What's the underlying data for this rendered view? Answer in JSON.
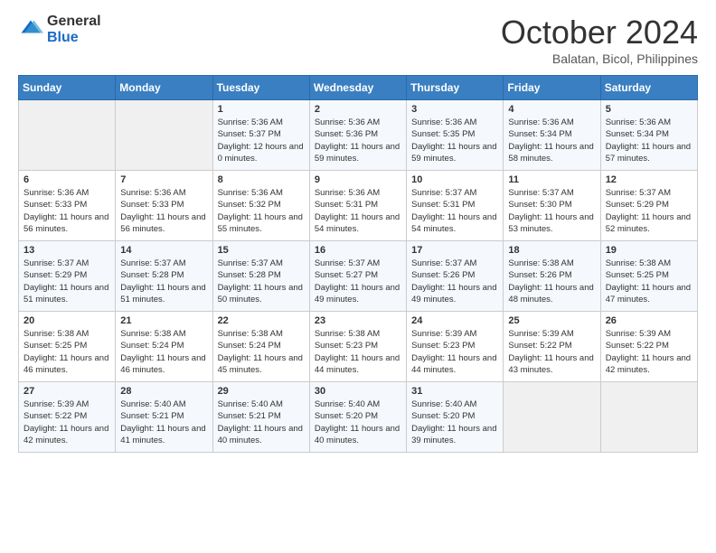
{
  "logo": {
    "general": "General",
    "blue": "Blue"
  },
  "header": {
    "month": "October 2024",
    "location": "Balatan, Bicol, Philippines"
  },
  "days_of_week": [
    "Sunday",
    "Monday",
    "Tuesday",
    "Wednesday",
    "Thursday",
    "Friday",
    "Saturday"
  ],
  "weeks": [
    [
      {
        "day": "",
        "info": ""
      },
      {
        "day": "",
        "info": ""
      },
      {
        "day": "1",
        "sunrise": "Sunrise: 5:36 AM",
        "sunset": "Sunset: 5:37 PM",
        "daylight": "Daylight: 12 hours and 0 minutes."
      },
      {
        "day": "2",
        "sunrise": "Sunrise: 5:36 AM",
        "sunset": "Sunset: 5:36 PM",
        "daylight": "Daylight: 11 hours and 59 minutes."
      },
      {
        "day": "3",
        "sunrise": "Sunrise: 5:36 AM",
        "sunset": "Sunset: 5:35 PM",
        "daylight": "Daylight: 11 hours and 59 minutes."
      },
      {
        "day": "4",
        "sunrise": "Sunrise: 5:36 AM",
        "sunset": "Sunset: 5:34 PM",
        "daylight": "Daylight: 11 hours and 58 minutes."
      },
      {
        "day": "5",
        "sunrise": "Sunrise: 5:36 AM",
        "sunset": "Sunset: 5:34 PM",
        "daylight": "Daylight: 11 hours and 57 minutes."
      }
    ],
    [
      {
        "day": "6",
        "sunrise": "Sunrise: 5:36 AM",
        "sunset": "Sunset: 5:33 PM",
        "daylight": "Daylight: 11 hours and 56 minutes."
      },
      {
        "day": "7",
        "sunrise": "Sunrise: 5:36 AM",
        "sunset": "Sunset: 5:33 PM",
        "daylight": "Daylight: 11 hours and 56 minutes."
      },
      {
        "day": "8",
        "sunrise": "Sunrise: 5:36 AM",
        "sunset": "Sunset: 5:32 PM",
        "daylight": "Daylight: 11 hours and 55 minutes."
      },
      {
        "day": "9",
        "sunrise": "Sunrise: 5:36 AM",
        "sunset": "Sunset: 5:31 PM",
        "daylight": "Daylight: 11 hours and 54 minutes."
      },
      {
        "day": "10",
        "sunrise": "Sunrise: 5:37 AM",
        "sunset": "Sunset: 5:31 PM",
        "daylight": "Daylight: 11 hours and 54 minutes."
      },
      {
        "day": "11",
        "sunrise": "Sunrise: 5:37 AM",
        "sunset": "Sunset: 5:30 PM",
        "daylight": "Daylight: 11 hours and 53 minutes."
      },
      {
        "day": "12",
        "sunrise": "Sunrise: 5:37 AM",
        "sunset": "Sunset: 5:29 PM",
        "daylight": "Daylight: 11 hours and 52 minutes."
      }
    ],
    [
      {
        "day": "13",
        "sunrise": "Sunrise: 5:37 AM",
        "sunset": "Sunset: 5:29 PM",
        "daylight": "Daylight: 11 hours and 51 minutes."
      },
      {
        "day": "14",
        "sunrise": "Sunrise: 5:37 AM",
        "sunset": "Sunset: 5:28 PM",
        "daylight": "Daylight: 11 hours and 51 minutes."
      },
      {
        "day": "15",
        "sunrise": "Sunrise: 5:37 AM",
        "sunset": "Sunset: 5:28 PM",
        "daylight": "Daylight: 11 hours and 50 minutes."
      },
      {
        "day": "16",
        "sunrise": "Sunrise: 5:37 AM",
        "sunset": "Sunset: 5:27 PM",
        "daylight": "Daylight: 11 hours and 49 minutes."
      },
      {
        "day": "17",
        "sunrise": "Sunrise: 5:37 AM",
        "sunset": "Sunset: 5:26 PM",
        "daylight": "Daylight: 11 hours and 49 minutes."
      },
      {
        "day": "18",
        "sunrise": "Sunrise: 5:38 AM",
        "sunset": "Sunset: 5:26 PM",
        "daylight": "Daylight: 11 hours and 48 minutes."
      },
      {
        "day": "19",
        "sunrise": "Sunrise: 5:38 AM",
        "sunset": "Sunset: 5:25 PM",
        "daylight": "Daylight: 11 hours and 47 minutes."
      }
    ],
    [
      {
        "day": "20",
        "sunrise": "Sunrise: 5:38 AM",
        "sunset": "Sunset: 5:25 PM",
        "daylight": "Daylight: 11 hours and 46 minutes."
      },
      {
        "day": "21",
        "sunrise": "Sunrise: 5:38 AM",
        "sunset": "Sunset: 5:24 PM",
        "daylight": "Daylight: 11 hours and 46 minutes."
      },
      {
        "day": "22",
        "sunrise": "Sunrise: 5:38 AM",
        "sunset": "Sunset: 5:24 PM",
        "daylight": "Daylight: 11 hours and 45 minutes."
      },
      {
        "day": "23",
        "sunrise": "Sunrise: 5:38 AM",
        "sunset": "Sunset: 5:23 PM",
        "daylight": "Daylight: 11 hours and 44 minutes."
      },
      {
        "day": "24",
        "sunrise": "Sunrise: 5:39 AM",
        "sunset": "Sunset: 5:23 PM",
        "daylight": "Daylight: 11 hours and 44 minutes."
      },
      {
        "day": "25",
        "sunrise": "Sunrise: 5:39 AM",
        "sunset": "Sunset: 5:22 PM",
        "daylight": "Daylight: 11 hours and 43 minutes."
      },
      {
        "day": "26",
        "sunrise": "Sunrise: 5:39 AM",
        "sunset": "Sunset: 5:22 PM",
        "daylight": "Daylight: 11 hours and 42 minutes."
      }
    ],
    [
      {
        "day": "27",
        "sunrise": "Sunrise: 5:39 AM",
        "sunset": "Sunset: 5:22 PM",
        "daylight": "Daylight: 11 hours and 42 minutes."
      },
      {
        "day": "28",
        "sunrise": "Sunrise: 5:40 AM",
        "sunset": "Sunset: 5:21 PM",
        "daylight": "Daylight: 11 hours and 41 minutes."
      },
      {
        "day": "29",
        "sunrise": "Sunrise: 5:40 AM",
        "sunset": "Sunset: 5:21 PM",
        "daylight": "Daylight: 11 hours and 40 minutes."
      },
      {
        "day": "30",
        "sunrise": "Sunrise: 5:40 AM",
        "sunset": "Sunset: 5:20 PM",
        "daylight": "Daylight: 11 hours and 40 minutes."
      },
      {
        "day": "31",
        "sunrise": "Sunrise: 5:40 AM",
        "sunset": "Sunset: 5:20 PM",
        "daylight": "Daylight: 11 hours and 39 minutes."
      },
      {
        "day": "",
        "info": ""
      },
      {
        "day": "",
        "info": ""
      }
    ]
  ]
}
